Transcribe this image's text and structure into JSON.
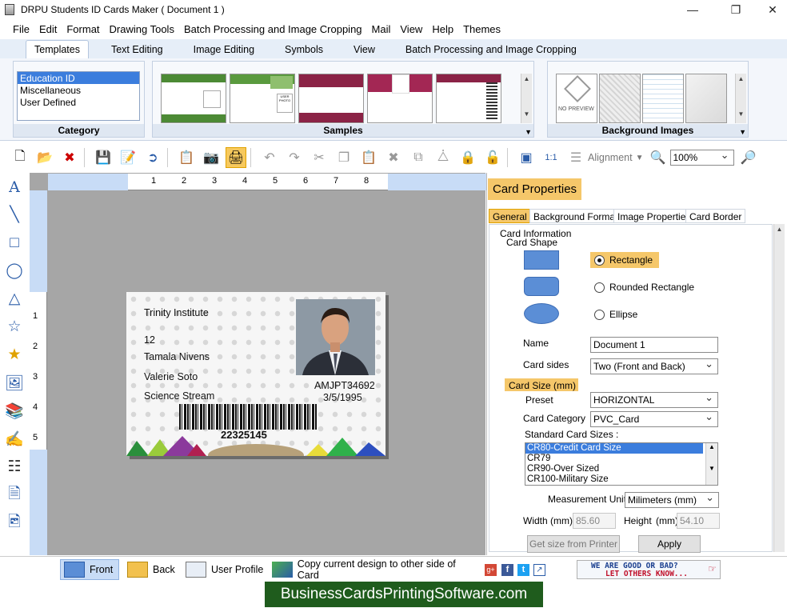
{
  "window": {
    "title": "DRPU Students ID Cards Maker ( Document 1 )"
  },
  "menu": [
    "File",
    "Edit",
    "Format",
    "Drawing Tools",
    "Batch Processing and Image Cropping",
    "Mail",
    "View",
    "Help",
    "Themes"
  ],
  "ribbon_tabs": [
    "Templates",
    "Text Editing",
    "Image Editing",
    "Symbols",
    "View",
    "Batch Processing and Image Cropping"
  ],
  "ribbon": {
    "category": {
      "label": "Category",
      "items": [
        "Education ID",
        "Miscellaneous",
        "User Defined"
      ],
      "selected": "Education ID"
    },
    "samples": {
      "label": "Samples",
      "photo_placeholder": "USER PHOTO"
    },
    "background_images": {
      "label": "Background Images",
      "no_preview": "NO PREVIEW"
    }
  },
  "toolbar": {
    "alignment_label": "Alignment",
    "zoom_value": "100%"
  },
  "ruler": {
    "h_ticks": [
      "1",
      "2",
      "3",
      "4",
      "5",
      "6",
      "7",
      "8"
    ],
    "v_ticks": [
      "1",
      "2",
      "3",
      "4",
      "5"
    ]
  },
  "card": {
    "institute": "Trinity Institute",
    "number": "12",
    "name": "Tamala Nivens",
    "line4": "Valerie Soto",
    "stream": "Science Stream",
    "id_code": "AMJPT34692",
    "date": "3/5/1995",
    "barcode_number": "22325145"
  },
  "properties": {
    "title": "Card Properties",
    "tabs": [
      "General",
      "Background Format",
      "Image Properties",
      "Card Border"
    ],
    "card_information": "Card Information",
    "card_shape": "Card Shape",
    "shapes": [
      "Rectangle",
      "Rounded Rectangle",
      "Ellipse"
    ],
    "selected_shape": "Rectangle",
    "name_label": "Name",
    "name_value": "Document 1",
    "card_sides_label": "Card sides",
    "card_sides_value": "Two (Front and Back)",
    "card_size_label": "Card Size (mm)",
    "preset_label": "Preset",
    "preset_value": "HORIZONTAL",
    "card_category_label": "Card Category",
    "card_category_value": "PVC_Card",
    "standard_sizes_label": "Standard Card Sizes :",
    "standard_sizes": [
      "CR80-Credit Card Size",
      "CR79",
      "CR90-Over Sized",
      "CR100-Military Size"
    ],
    "selected_size": "CR80-Credit Card Size",
    "measurement_label": "Measurement Unit :",
    "measurement_value": "Milimeters (mm)",
    "width_label": "Width",
    "width_unit": "(mm)",
    "width_value": "85.60",
    "height_label": "Height",
    "height_unit": "(mm)",
    "height_value": "54.10",
    "get_size_button": "Get size from Printer",
    "apply_button": "Apply"
  },
  "bottom": {
    "front": "Front",
    "back": "Back",
    "user_profile": "User Profile",
    "copy_design": "Copy current design to other side of Card",
    "feedback_line1": "WE ARE GOOD OR BAD?",
    "feedback_line2": "LET OTHERS KNOW..."
  },
  "banner": "BusinessCardsPrintingSoftware.com",
  "colors": {
    "accent": "#f5c76a",
    "selection": "#3b7ddd",
    "banner": "#1f5c1d",
    "ruler": "#c8dcf6"
  }
}
